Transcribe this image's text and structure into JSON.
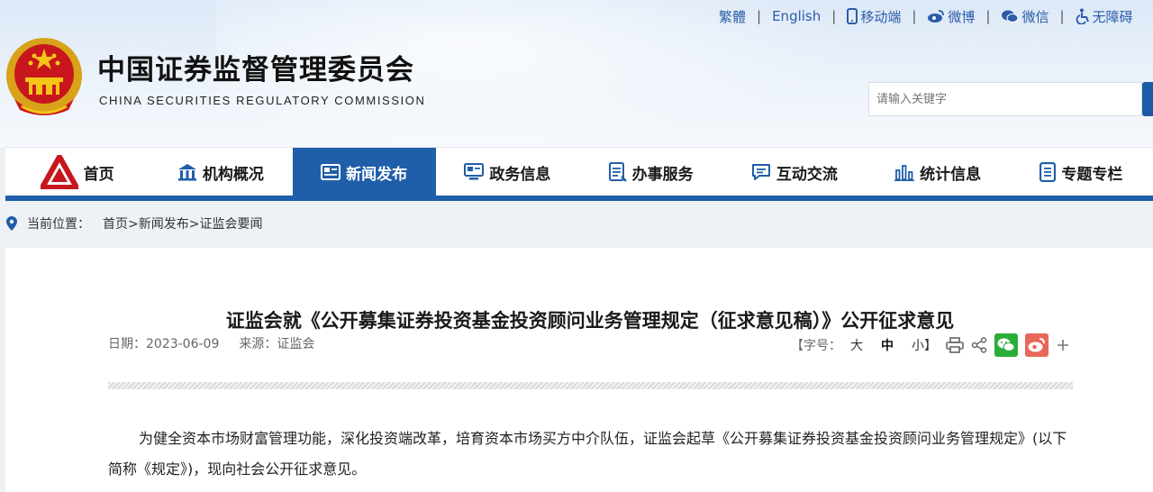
{
  "header": {
    "title": "中国证券监督管理委员会",
    "subtitle": "CHINA SECURITIES REGULATORY COMMISSION",
    "top_links": {
      "traditional": "繁體",
      "english": "English",
      "mobile": "移动端",
      "weibo": "微博",
      "wechat": "微信",
      "accessibility": "无障碍"
    },
    "search_placeholder": "请输入关键字"
  },
  "nav": {
    "items": [
      {
        "label": "首页",
        "icon": "csrc-logo-icon"
      },
      {
        "label": "机构概况",
        "icon": "building-icon"
      },
      {
        "label": "新闻发布",
        "icon": "news-icon",
        "active": true
      },
      {
        "label": "政务信息",
        "icon": "screen-icon"
      },
      {
        "label": "办事服务",
        "icon": "document-icon"
      },
      {
        "label": "互动交流",
        "icon": "chat-icon"
      },
      {
        "label": "统计信息",
        "icon": "bar-chart-icon"
      },
      {
        "label": "专题专栏",
        "icon": "file-icon"
      }
    ],
    "active_color": "#1f5ea9"
  },
  "breadcrumb": {
    "label": "当前位置：",
    "path": "首页>新闻发布>证监会要闻"
  },
  "article": {
    "title": "证监会就《公开募集证券投资基金投资顾问业务管理规定（征求意见稿）》公开征求意见",
    "date": "日期：2023-06-09",
    "source": "来源：证监会",
    "font_size_label": "【字号：",
    "size_large": "大",
    "size_medium": "中",
    "size_small": "小】",
    "body": "为健全资本市场财富管理功能，深化投资端改革，培育资本市场买方中介队伍，证监会起草《公开募集证券投资基金投资顾问业务管理规定》(以下简称《规定》)，现向社会公开征求意见。"
  }
}
